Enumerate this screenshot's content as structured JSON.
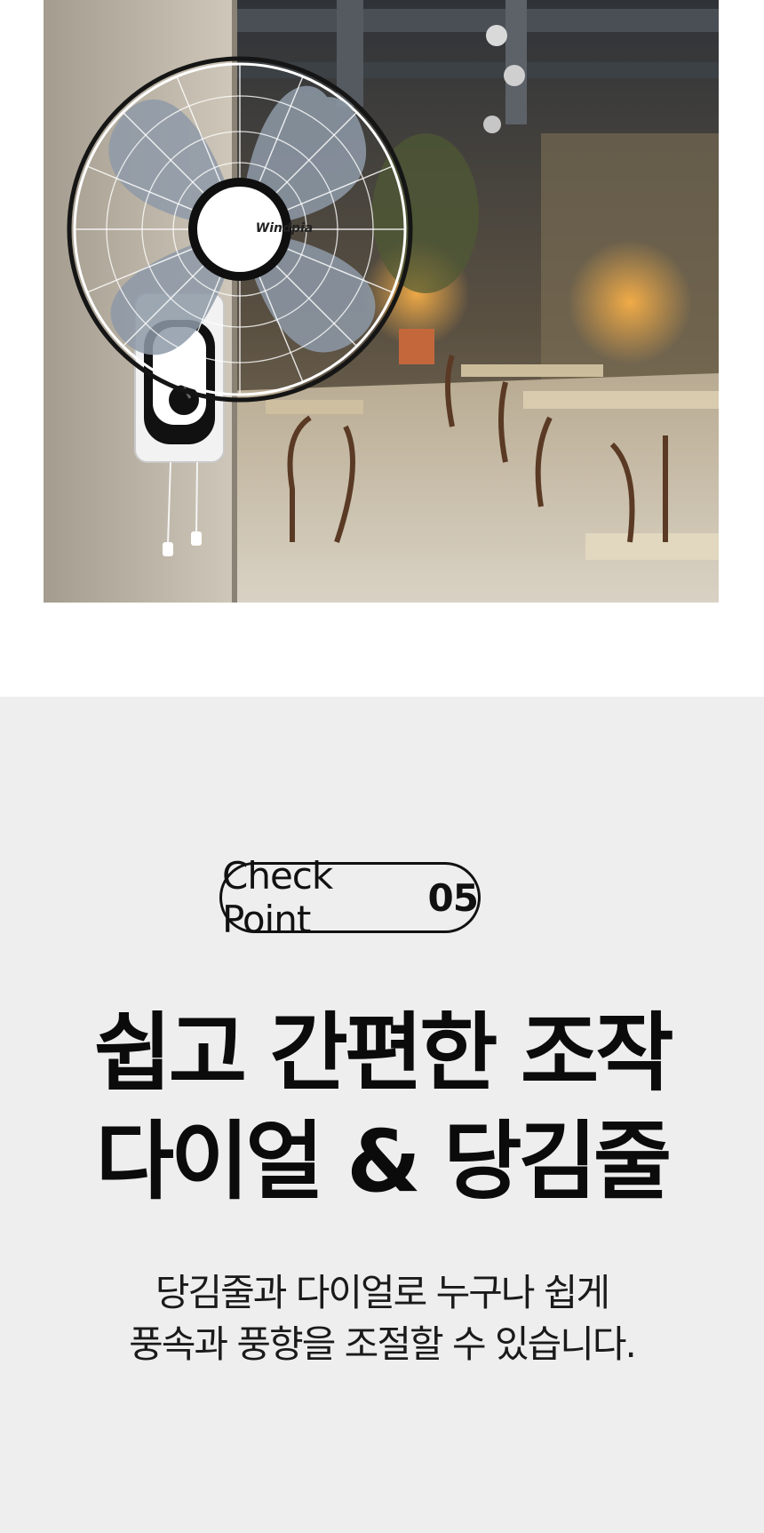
{
  "hero": {
    "brand_logo": "Windpia",
    "image_subject": "wall-mounted fan in restaurant",
    "colors": {
      "fan_blade": "#8e9aa8",
      "cafe_warm": "#c58a3c"
    }
  },
  "check_point": {
    "label": "Check Point",
    "number": "05"
  },
  "headline": {
    "line1": "쉽고 간편한 조작",
    "line2": "다이얼 & 당김줄"
  },
  "description": {
    "line1": "당김줄과 다이얼로 누구나 쉽게",
    "line2": "풍속과 풍향을 조절할 수 있습니다."
  }
}
